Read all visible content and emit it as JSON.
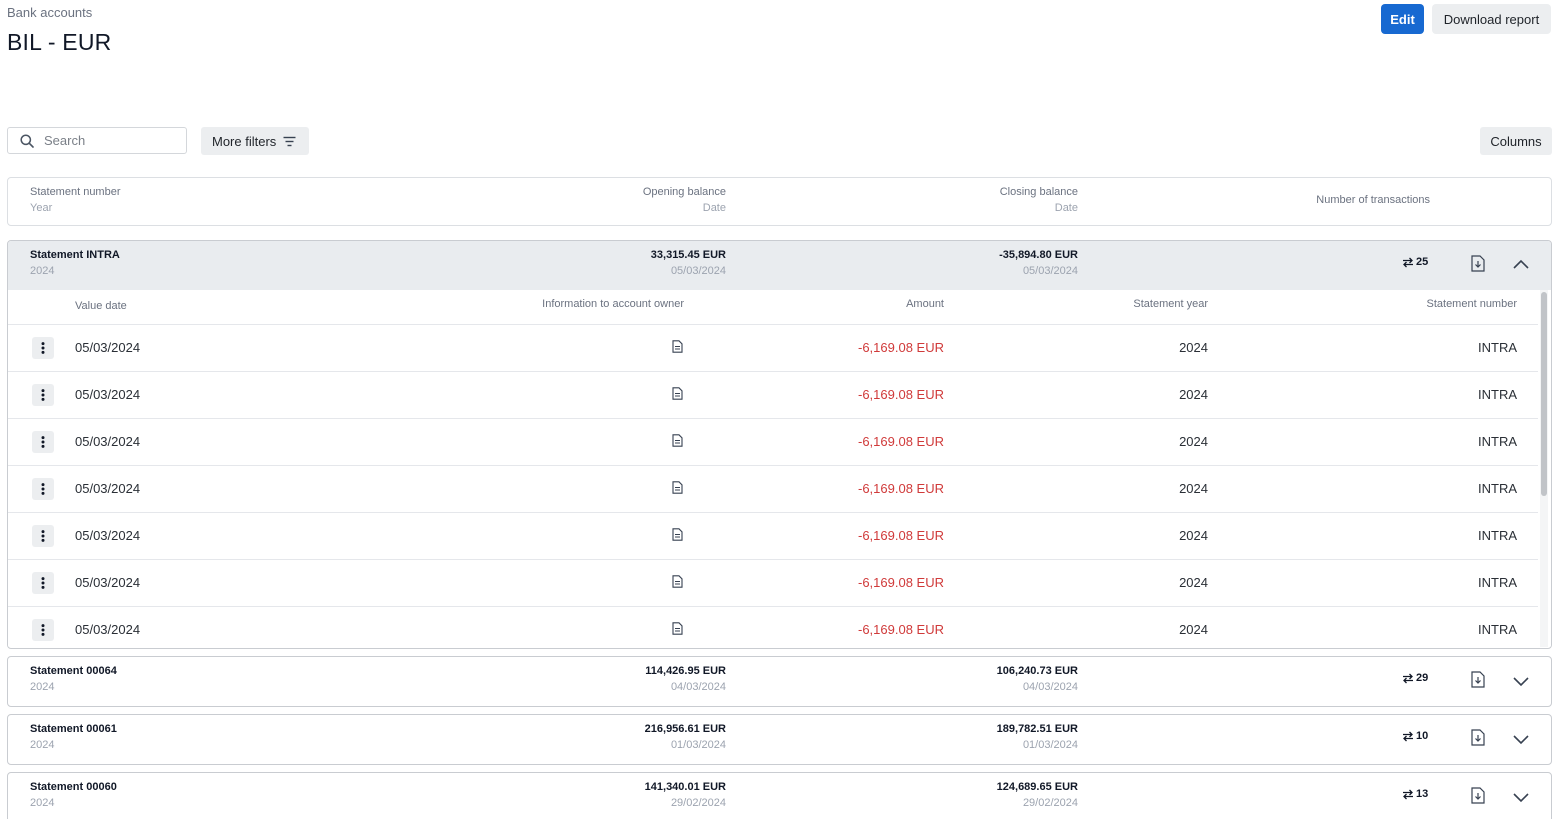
{
  "breadcrumb": "Bank accounts",
  "title": "BIL - EUR",
  "actions": {
    "edit": "Edit",
    "download": "Download report"
  },
  "toolbar": {
    "search_placeholder": "Search",
    "more_filters": "More filters",
    "columns": "Columns"
  },
  "columns": {
    "statement_number": "Statement number",
    "year": "Year",
    "opening_balance": "Opening balance",
    "closing_balance": "Closing balance",
    "date": "Date",
    "num_transactions": "Number of transactions"
  },
  "statements": [
    {
      "name": "Statement INTRA",
      "year": "2024",
      "opening": "33,315.45 EUR",
      "opening_date": "05/03/2024",
      "closing": "-35,894.80 EUR",
      "closing_date": "05/03/2024",
      "count": "25",
      "expanded": true
    },
    {
      "name": "Statement 00064",
      "year": "2024",
      "opening": "114,426.95 EUR",
      "opening_date": "04/03/2024",
      "closing": "106,240.73 EUR",
      "closing_date": "04/03/2024",
      "count": "29",
      "expanded": false
    },
    {
      "name": "Statement 00061",
      "year": "2024",
      "opening": "216,956.61 EUR",
      "opening_date": "01/03/2024",
      "closing": "189,782.51 EUR",
      "closing_date": "01/03/2024",
      "count": "10",
      "expanded": false
    },
    {
      "name": "Statement 00060",
      "year": "2024",
      "opening": "141,340.01 EUR",
      "opening_date": "29/02/2024",
      "closing": "124,689.65 EUR",
      "closing_date": "29/02/2024",
      "count": "13",
      "expanded": false
    }
  ],
  "transaction_columns": {
    "value_date": "Value date",
    "info": "Information to account owner",
    "amount": "Amount",
    "statement_year": "Statement year",
    "statement_number": "Statement number"
  },
  "transactions": [
    {
      "value_date": "05/03/2024",
      "amount": "-6,169.08 EUR",
      "statement_year": "2024",
      "statement_number": "INTRA"
    },
    {
      "value_date": "05/03/2024",
      "amount": "-6,169.08 EUR",
      "statement_year": "2024",
      "statement_number": "INTRA"
    },
    {
      "value_date": "05/03/2024",
      "amount": "-6,169.08 EUR",
      "statement_year": "2024",
      "statement_number": "INTRA"
    },
    {
      "value_date": "05/03/2024",
      "amount": "-6,169.08 EUR",
      "statement_year": "2024",
      "statement_number": "INTRA"
    },
    {
      "value_date": "05/03/2024",
      "amount": "-6,169.08 EUR",
      "statement_year": "2024",
      "statement_number": "INTRA"
    },
    {
      "value_date": "05/03/2024",
      "amount": "-6,169.08 EUR",
      "statement_year": "2024",
      "statement_number": "INTRA"
    },
    {
      "value_date": "05/03/2024",
      "amount": "-6,169.08 EUR",
      "statement_year": "2024",
      "statement_number": "INTRA"
    }
  ],
  "icons": {
    "search": "search-icon",
    "filter": "filter-icon",
    "transactions": "transfer-icon",
    "download": "file-download-icon",
    "info": "document-icon",
    "kebab": "more-vertical-icon",
    "collapse": "chevron-up-icon",
    "expand": "chevron-down-icon"
  },
  "colors": {
    "primary": "#1769d1",
    "negative": "#d03a3a",
    "expanded_bg": "#e9ecef"
  }
}
